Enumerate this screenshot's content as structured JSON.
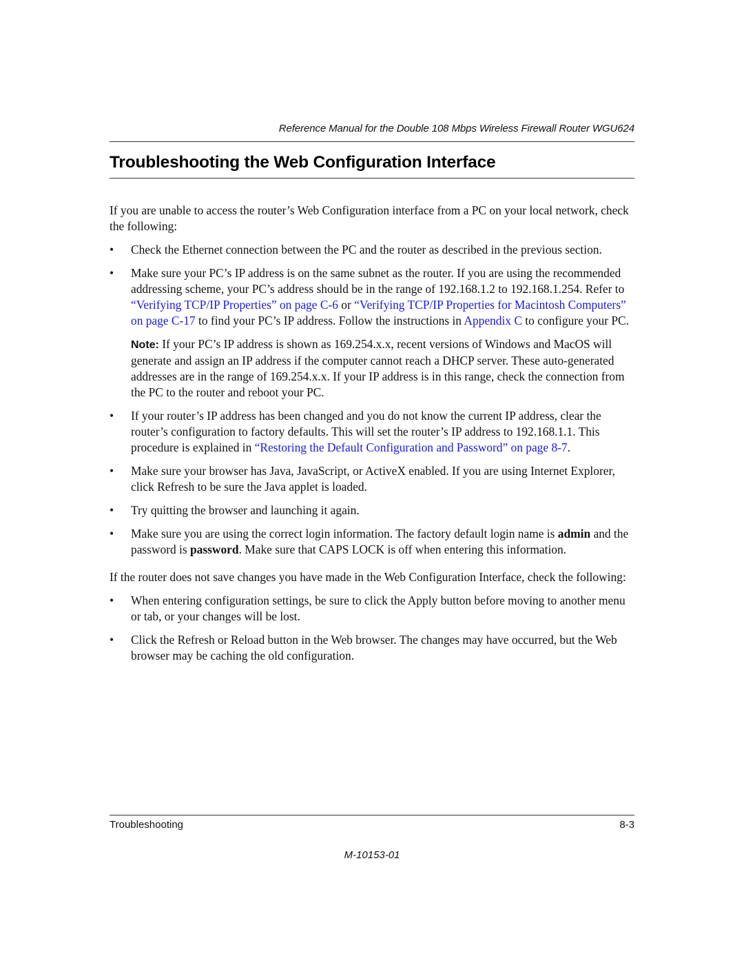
{
  "header": {
    "running_title": "Reference Manual for the Double 108 Mbps Wireless Firewall Router WGU624"
  },
  "section": {
    "title": "Troubleshooting the Web Configuration Interface"
  },
  "content": {
    "intro": "If you are unable to access the router’s Web Configuration interface from a PC on your local network, check the following:",
    "bullet_symbol": "•",
    "bullet1": "Check the Ethernet connection between the PC and the router as described in the previous section.",
    "bullet2": {
      "text_a": "Make sure your PC’s IP address is on the same subnet as the router. If you are using the recommended addressing scheme, your PC’s address should be in the range of 192.168.1.2 to 192.168.1.254. Refer to ",
      "link1": "“Verifying TCP/IP Properties” on page C-6",
      "text_b": " or ",
      "link2": "“Verifying TCP/IP Properties for Macintosh Computers” on page C-17",
      "text_c": " to find your PC’s IP address. Follow the instructions in ",
      "link3": "Appendix C",
      "text_d": " to configure your PC."
    },
    "note": {
      "label": "Note:",
      "text": " If your PC’s IP address is shown as 169.254.x.x, recent versions of Windows and MacOS will generate and assign an IP address if the computer cannot reach a DHCP server. These auto-generated addresses are in the range of 169.254.x.x. If your IP address is in this range, check the connection from the PC to the router and reboot your PC."
    },
    "bullet3": {
      "text_a": "If your router’s IP address has been changed and you do not know the current IP address, clear the router’s configuration to factory defaults. This will set the router’s IP address to 192.168.1.1. This procedure is explained in ",
      "link": "“Restoring the Default Configuration and Password” on page 8-7",
      "text_b": "."
    },
    "bullet4": "Make sure your browser has Java, JavaScript, or ActiveX enabled. If you are using Internet Explorer, click Refresh to be sure the Java applet is loaded.",
    "bullet5": "Try quitting the browser and launching it again.",
    "bullet6": {
      "text_a": "Make sure you are using the correct login information. The factory default login name is ",
      "bold1": "admin",
      "text_b": " and the password is ",
      "bold2": "password",
      "text_c": ". Make sure that CAPS LOCK is off when entering this information."
    },
    "intro2": "If the router does not save changes you have made in the Web Configuration Interface, check the following:",
    "bullet7": "When entering configuration settings, be sure to click the Apply button before moving to another menu or tab, or your changes will be lost.",
    "bullet8": "Click the Refresh or Reload button in the Web browser. The changes may have occurred, but the Web browser may be caching the old configuration."
  },
  "footer": {
    "chapter": "Troubleshooting",
    "page_number": "8-3",
    "doc_number": "M-10153-01"
  },
  "colors": {
    "link": "#1a1adb",
    "text": "#111111",
    "rule": "#333333"
  }
}
